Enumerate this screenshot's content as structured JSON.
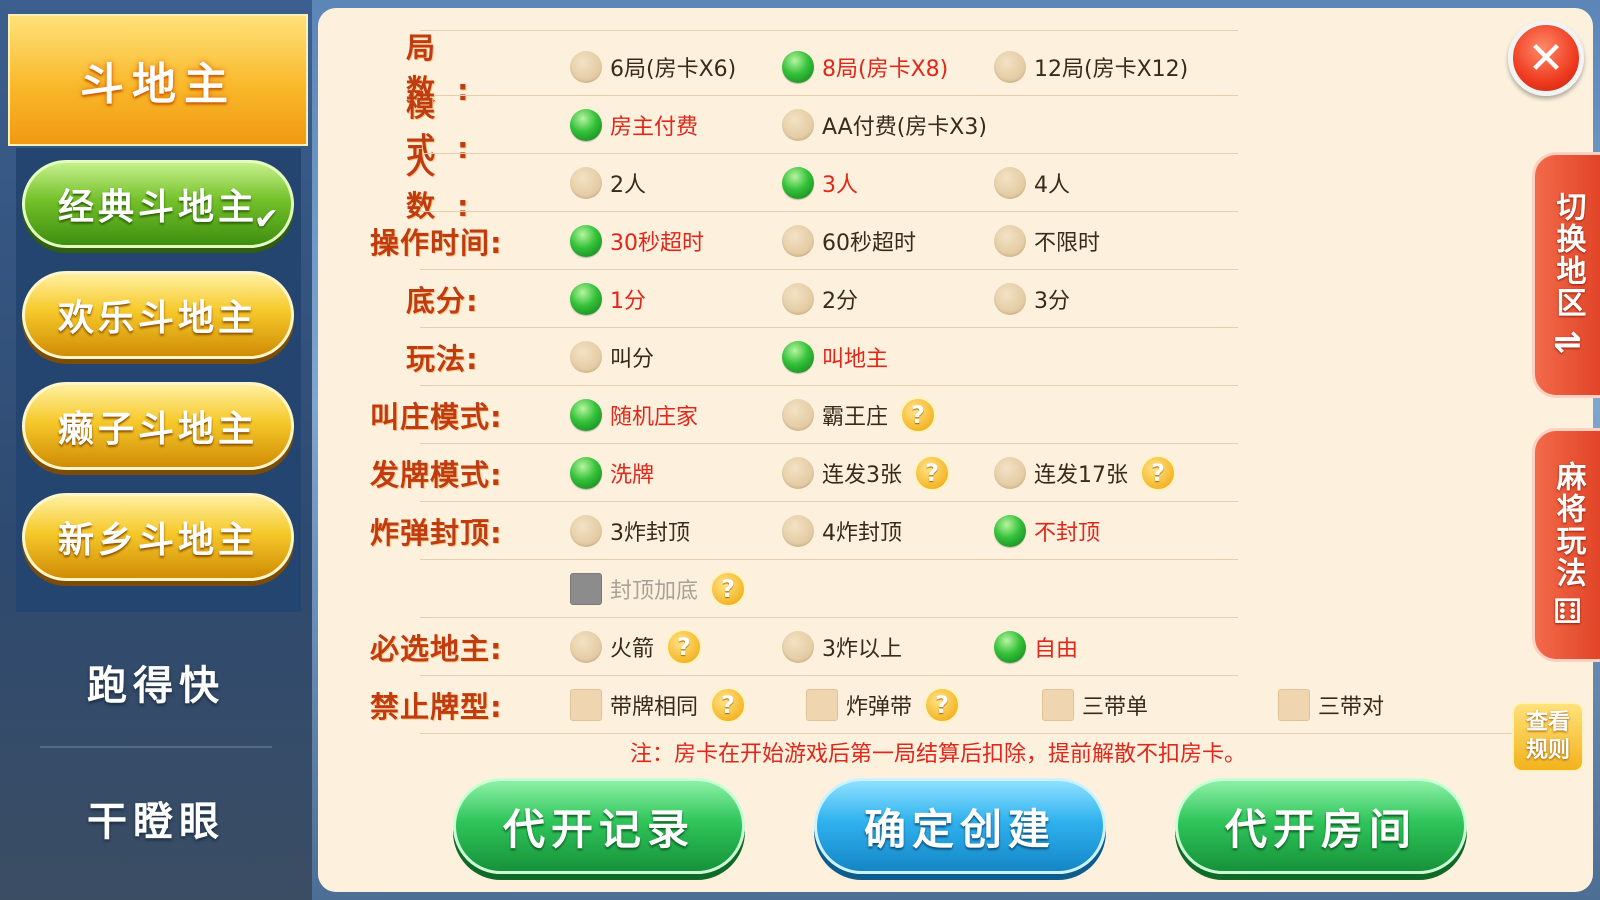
{
  "sidebar": {
    "header": "斗地主",
    "modes": [
      {
        "label": "经典斗地主",
        "selected": true
      },
      {
        "label": "欢乐斗地主",
        "selected": false
      },
      {
        "label": "癞子斗地主",
        "selected": false
      },
      {
        "label": "新乡斗地主",
        "selected": false
      }
    ],
    "others": [
      "跑得快",
      "干瞪眼"
    ]
  },
  "rows": [
    {
      "label": "局 数:",
      "options": [
        {
          "text": "6局(房卡X6)",
          "sel": false
        },
        {
          "text": "8局(房卡X8)",
          "sel": true
        },
        {
          "text": "12局(房卡X12)",
          "sel": false
        }
      ]
    },
    {
      "label": "模 式:",
      "options": [
        {
          "text": "房主付费",
          "sel": true
        },
        {
          "text": "AA付费(房卡X3)",
          "sel": false
        }
      ]
    },
    {
      "label": "人 数:",
      "options": [
        {
          "text": "2人",
          "sel": false
        },
        {
          "text": "3人",
          "sel": true
        },
        {
          "text": "4人",
          "sel": false
        }
      ]
    },
    {
      "label": "操作时间:",
      "options": [
        {
          "text": "30秒超时",
          "sel": true
        },
        {
          "text": "60秒超时",
          "sel": false
        },
        {
          "text": "不限时",
          "sel": false
        }
      ]
    },
    {
      "label": "底分:",
      "options": [
        {
          "text": "1分",
          "sel": true
        },
        {
          "text": "2分",
          "sel": false
        },
        {
          "text": "3分",
          "sel": false
        }
      ]
    },
    {
      "label": "玩法:",
      "options": [
        {
          "text": "叫分",
          "sel": false
        },
        {
          "text": "叫地主",
          "sel": true
        }
      ]
    },
    {
      "label": "叫庄模式:",
      "options": [
        {
          "text": "随机庄家",
          "sel": true
        },
        {
          "text": "霸王庄",
          "sel": false,
          "help": true
        }
      ]
    },
    {
      "label": "发牌模式:",
      "options": [
        {
          "text": "洗牌",
          "sel": true
        },
        {
          "text": "连发3张",
          "sel": false,
          "help": true
        },
        {
          "text": "连发17张",
          "sel": false,
          "help": true
        }
      ]
    },
    {
      "label": "炸弹封顶:",
      "options": [
        {
          "text": "3炸封顶",
          "sel": false
        },
        {
          "text": "4炸封顶",
          "sel": false
        },
        {
          "text": "不封顶",
          "sel": true
        }
      ]
    },
    {
      "label": "",
      "options": [
        {
          "text": "封顶加底",
          "checkbox": true,
          "disabled": true,
          "help": true
        }
      ]
    },
    {
      "label": "必选地主:",
      "options": [
        {
          "text": "火箭",
          "sel": false,
          "help": true
        },
        {
          "text": "3炸以上",
          "sel": false
        },
        {
          "text": "自由",
          "sel": true
        }
      ]
    },
    {
      "label": "禁止牌型:",
      "options": [
        {
          "text": "带牌相同",
          "checkbox": true,
          "help": true
        },
        {
          "text": "炸弹带",
          "checkbox": true,
          "help": true
        },
        {
          "text": "三带单",
          "checkbox": true
        },
        {
          "text": "三带对",
          "checkbox": true
        }
      ]
    }
  ],
  "help_glyph": "?",
  "note": "注：房卡在开始游戏后第一局结算后扣除，提前解散不扣房卡。",
  "buttons": {
    "records": "代开记录",
    "create": "确定创建",
    "proxy_room": "代开房间"
  },
  "close_glyph": "✕",
  "right_tabs": {
    "switch_region": "切换地区",
    "switch_glyph": "⇌",
    "mahjong": "麻将玩法",
    "mahjong_glyph": "⚅"
  },
  "rules_button": "查看规则"
}
